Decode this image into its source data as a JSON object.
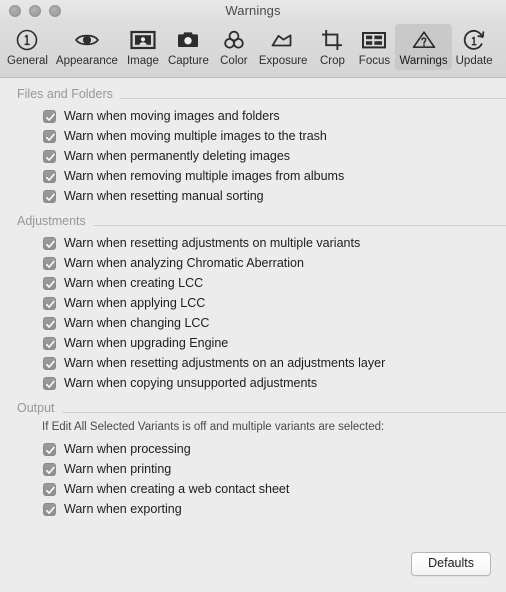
{
  "window": {
    "title": "Warnings",
    "traffic_lights": [
      "close",
      "minimize",
      "zoom"
    ]
  },
  "toolbar": {
    "items": [
      {
        "label": "General",
        "icon": "numbered-circle-one-icon",
        "selected": false
      },
      {
        "label": "Appearance",
        "icon": "eye-icon",
        "selected": false
      },
      {
        "label": "Image",
        "icon": "portrait-photo-icon",
        "selected": false
      },
      {
        "label": "Capture",
        "icon": "camera-icon",
        "selected": false
      },
      {
        "label": "Color",
        "icon": "three-circles-icon",
        "selected": false
      },
      {
        "label": "Exposure",
        "icon": "curve-histogram-icon",
        "selected": false
      },
      {
        "label": "Crop",
        "icon": "crop-marks-icon",
        "selected": false
      },
      {
        "label": "Focus",
        "icon": "panel-grid-icon",
        "selected": false
      },
      {
        "label": "Warnings",
        "icon": "warning-triangle-question-icon",
        "selected": true
      },
      {
        "label": "Update",
        "icon": "refresh-circle-one-icon",
        "selected": false
      }
    ]
  },
  "sections": [
    {
      "title": "Files and Folders",
      "note": null,
      "options": [
        {
          "label": "Warn when moving images and folders",
          "checked": true
        },
        {
          "label": "Warn when moving multiple images to the trash",
          "checked": true
        },
        {
          "label": "Warn when permanently deleting images",
          "checked": true
        },
        {
          "label": "Warn when removing multiple images from albums",
          "checked": true
        },
        {
          "label": "Warn when resetting manual sorting",
          "checked": true
        }
      ]
    },
    {
      "title": "Adjustments",
      "note": null,
      "options": [
        {
          "label": "Warn when resetting adjustments on multiple variants",
          "checked": true
        },
        {
          "label": "Warn when analyzing Chromatic Aberration",
          "checked": true
        },
        {
          "label": "Warn when creating LCC",
          "checked": true
        },
        {
          "label": "Warn when applying LCC",
          "checked": true
        },
        {
          "label": "Warn when changing LCC",
          "checked": true
        },
        {
          "label": "Warn when upgrading Engine",
          "checked": true
        },
        {
          "label": "Warn when resetting adjustments on an adjustments layer",
          "checked": true
        },
        {
          "label": "Warn when copying unsupported adjustments",
          "checked": true
        }
      ]
    },
    {
      "title": "Output",
      "note": "If Edit All Selected Variants is off and multiple variants are selected:",
      "options": [
        {
          "label": "Warn when processing",
          "checked": true
        },
        {
          "label": "Warn when printing",
          "checked": true
        },
        {
          "label": "Warn when creating a web contact sheet",
          "checked": true
        },
        {
          "label": "Warn when exporting",
          "checked": true
        }
      ]
    }
  ],
  "footer": {
    "defaults_label": "Defaults"
  },
  "colors": {
    "window_background": "#ececec",
    "toolbar_top": "#dedede",
    "toolbar_bottom": "#d4d4d4",
    "toolbar_selected": "#c9c9c9",
    "section_title": "#98979a",
    "rule": "#d2d2d2",
    "checkbox_fill": "#949494",
    "checkbox_mark": "#ffffff",
    "label_text": "#1d1d1f",
    "title_text": "#4b4b4b"
  }
}
